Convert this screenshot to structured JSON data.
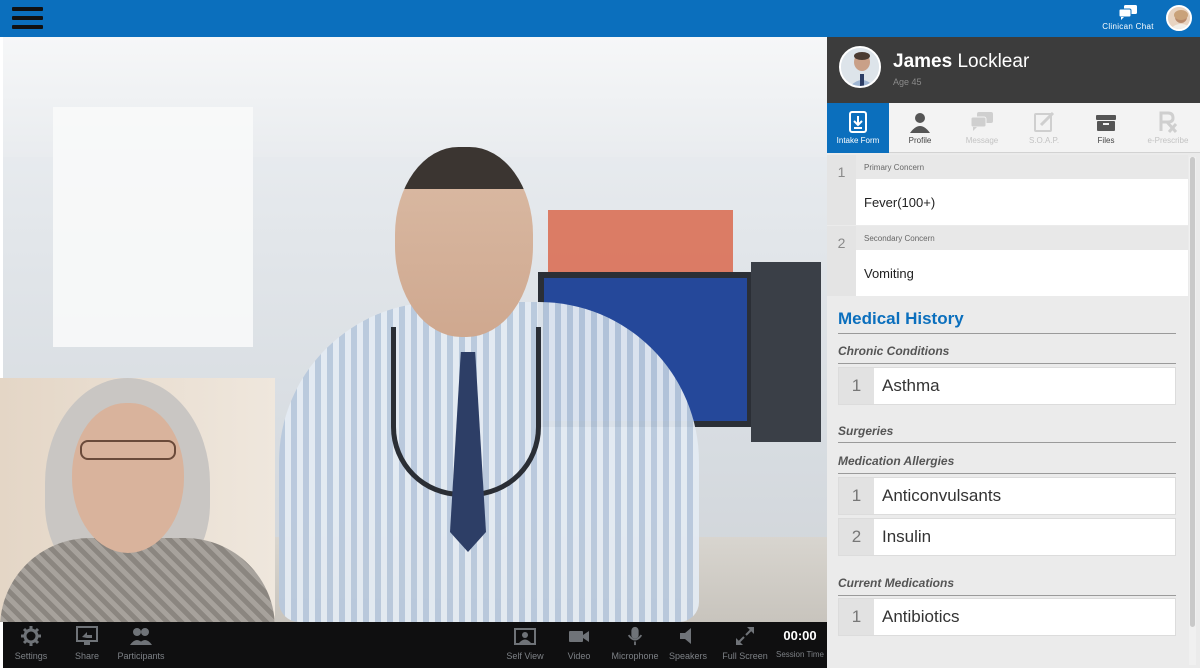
{
  "topbar": {
    "chat_label": "Clinican Chat"
  },
  "toolbar": {
    "settings": "Settings",
    "share": "Share",
    "participants": "Participants",
    "self_view": "Self View",
    "video": "Video",
    "microphone": "Microphone",
    "speakers": "Speakers",
    "full_screen": "Full Screen",
    "session_time_value": "00:00",
    "session_time_label": "Session Time"
  },
  "patient": {
    "first_name": "James",
    "last_name": " Locklear",
    "age": "Age 45"
  },
  "tabs": [
    {
      "label": "Intake Form"
    },
    {
      "label": "Profile"
    },
    {
      "label": "Message"
    },
    {
      "label": "S.O.A.P."
    },
    {
      "label": "Files"
    },
    {
      "label": "e-Prescribe"
    }
  ],
  "concerns": [
    {
      "num": "1",
      "label": "Primary Concern",
      "value": "Fever(100+)"
    },
    {
      "num": "2",
      "label": "Secondary Concern",
      "value": "Vomiting"
    }
  ],
  "medical_history": {
    "title": "Medical History",
    "chronic_title": "Chronic Conditions",
    "chronic": [
      {
        "num": "1",
        "value": "Asthma"
      }
    ],
    "surgeries_title": "Surgeries",
    "allergies_title": "Medication Allergies",
    "allergies": [
      {
        "num": "1",
        "value": "Anticonvulsants"
      },
      {
        "num": "2",
        "value": "Insulin"
      }
    ],
    "medications_title": "Current Medications",
    "medications": [
      {
        "num": "1",
        "value": "Antibiotics"
      }
    ]
  },
  "colors": {
    "brand_blue": "#0b6fbd",
    "header_dark": "#3c3c3c",
    "toolbar_black": "#0f0f10"
  }
}
